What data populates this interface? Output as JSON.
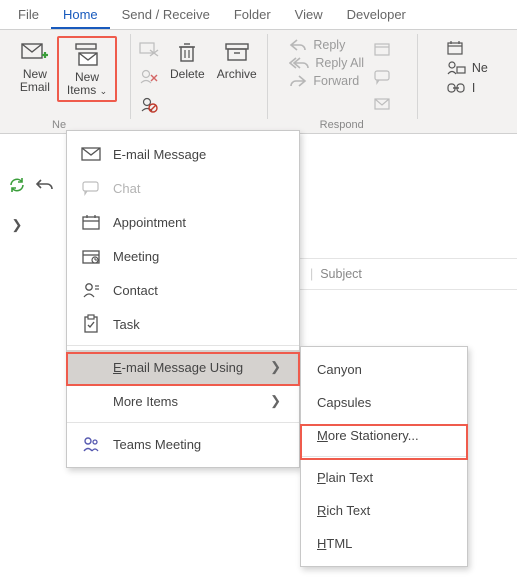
{
  "tabs": {
    "file": "File",
    "home": "Home",
    "send_receive": "Send / Receive",
    "folder": "Folder",
    "view": "View",
    "developer": "Developer"
  },
  "ribbon": {
    "new_email": "New\nEmail",
    "new_items": "New\nItems",
    "delete": "Delete",
    "archive": "Archive",
    "group_new": "Ne",
    "group_respond": "Respond",
    "reply": "Reply",
    "reply_all": "Reply All",
    "forward": "Forward",
    "right_item2": "Ne"
  },
  "menu1": {
    "email": "E-mail Message",
    "chat": "Chat",
    "appointment": "Appointment",
    "meeting": "Meeting",
    "contact": "Contact",
    "task": "Task",
    "using": "E-mail Message Using",
    "more": "More Items",
    "teams": "Teams Meeting"
  },
  "menu2": {
    "canyon": "Canyon",
    "capsules": "Capsules",
    "more_stationery": "More Stationery...",
    "plain": "Plain Text",
    "rich": "Rich Text",
    "html": "HTML"
  },
  "subject_label": "Subject"
}
